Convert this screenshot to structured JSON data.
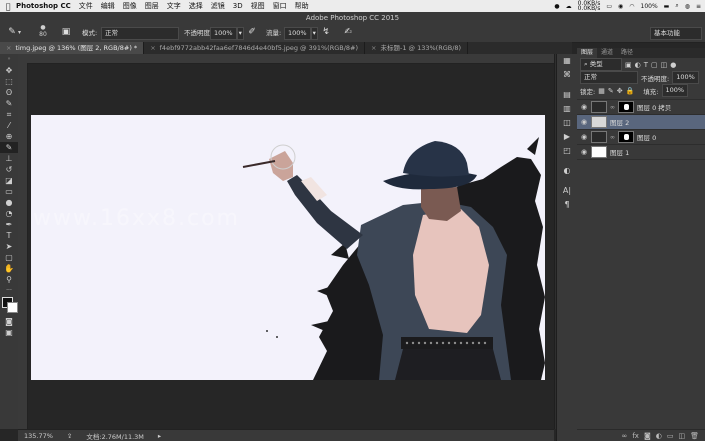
{
  "menubar": {
    "apple": "",
    "app_name": "Photoshop CC",
    "items": [
      "文件",
      "编辑",
      "图像",
      "图层",
      "文字",
      "选择",
      "滤镜",
      "3D",
      "视图",
      "窗口",
      "帮助"
    ],
    "net_up": "0.0KB/s",
    "net_down": "0.0KB/s",
    "battery": "100%"
  },
  "window": {
    "title": "Adobe Photoshop CC 2015"
  },
  "options": {
    "brush_size": "80",
    "mode_label": "模式:",
    "mode_value": "正常",
    "opacity_label": "不透明度:",
    "opacity_value": "100%",
    "flow_label": "流量:",
    "flow_value": "100%",
    "workspace": "基本功能"
  },
  "tabs": [
    {
      "label": "timg.jpeg @ 136% (图层 2, RGB/8#) *"
    },
    {
      "label": "f4ebf9772abb42faa6ef7846d4e40bf5.jpeg @ 391%(RGB/8#)"
    },
    {
      "label": "未标题-1 @ 133%(RGB/8)"
    }
  ],
  "status": {
    "zoom": "135.77%",
    "doc": "文档:2.76M/11.3M"
  },
  "watermark": "www.16xx8.com",
  "layers_panel": {
    "tabs": [
      "图层",
      "通道",
      "路径"
    ],
    "filter_kind": "类型",
    "blend_mode": "正常",
    "opacity_label": "不透明度:",
    "opacity_value": "100%",
    "lock_label": "锁定:",
    "fill_label": "填充:",
    "fill_value": "100%",
    "layers": [
      {
        "name": "图层 0 拷贝",
        "selected": false,
        "has_mask": true
      },
      {
        "name": "图层 2",
        "selected": true,
        "has_mask": false
      },
      {
        "name": "图层 0",
        "selected": false,
        "has_mask": true
      },
      {
        "name": "图层 1",
        "selected": false,
        "has_mask": false
      }
    ]
  }
}
